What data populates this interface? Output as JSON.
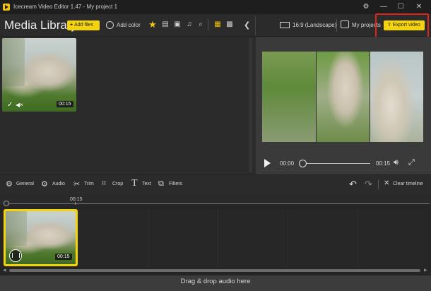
{
  "window": {
    "title": "Icecream Video Editor 1.47  -  My project 1",
    "settings_icon": "gear-icon",
    "minimize_glyph": "—",
    "maximize_glyph": "☐",
    "close_glyph": "✕"
  },
  "media_library": {
    "title": "Media Library",
    "add_files_label": "Add files",
    "add_color_label": "Add color",
    "filters": [
      "star-icon",
      "film-icon",
      "image-icon",
      "music-icon",
      "search-icon"
    ],
    "view_modes": [
      "grid-large-icon",
      "grid-small-icon"
    ],
    "items": [
      {
        "duration": "00:15",
        "check": "✓",
        "mute": "◀×"
      }
    ]
  },
  "preview": {
    "aspect_label": "16:9 (Landscape)",
    "my_projects_label": "My projects",
    "export_label": "Export video",
    "time_current": "00:00",
    "time_total": "00:15",
    "progress": 0
  },
  "tools": [
    {
      "icon": "gear-icon",
      "label": "General"
    },
    {
      "icon": "audio-gear-icon",
      "label": "Audio"
    },
    {
      "icon": "scissors-icon",
      "label": "Trim"
    },
    {
      "icon": "crop-icon",
      "label": "Crop"
    },
    {
      "icon": "text-icon",
      "label": "Text"
    },
    {
      "icon": "filters-icon",
      "label": "Filters"
    }
  ],
  "timeline": {
    "clear_label": "Clear timeline",
    "ruler_label": "00:15",
    "clip_duration": "00:15",
    "audio_drop_label": "Drag & drop audio here"
  },
  "colors": {
    "accent": "#f4d20d",
    "highlight": "#e0231b",
    "background": "#2b2b2b"
  }
}
